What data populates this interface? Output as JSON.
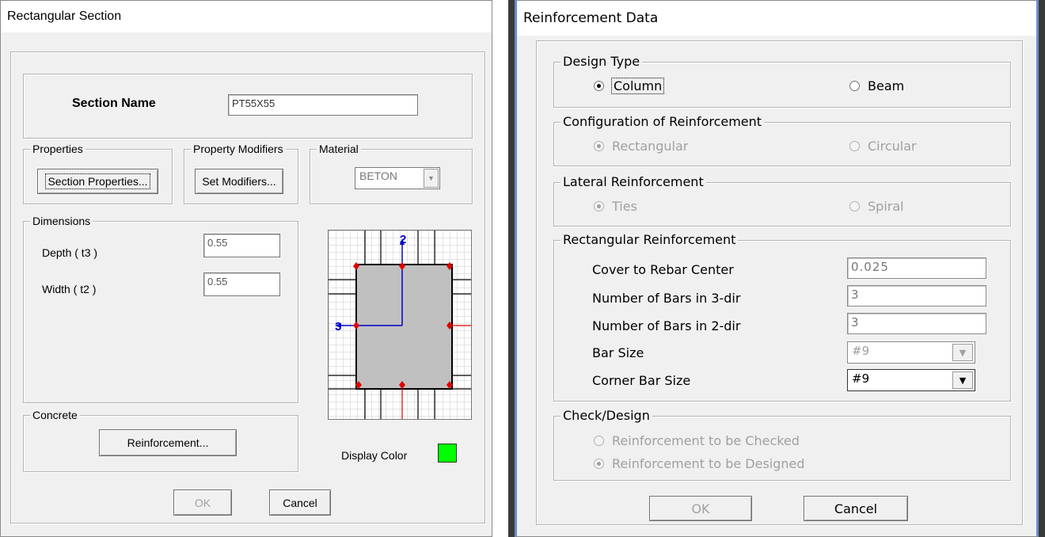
{
  "left_dialog": {
    "title": "Rectangular Section",
    "section_name_label": "Section Name",
    "section_name_value": "PT55X55",
    "properties_group": "Properties",
    "section_properties_button": "Section Properties...",
    "modifiers_group": "Property Modifiers",
    "set_modifiers_button": "Set Modifiers...",
    "material_group": "Material",
    "material_value": "BETON",
    "dimensions_group": "Dimensions",
    "depth_label": "Depth ( t3 )",
    "depth_value": "0.55",
    "width_label": "Width ( t2 )",
    "width_value": "0.55",
    "axis_2": "2",
    "axis_3": "3",
    "concrete_group": "Concrete",
    "reinforcement_button": "Reinforcement...",
    "display_color_label": "Display Color",
    "display_color": "#00ff00",
    "ok_button": "OK",
    "cancel_button": "Cancel"
  },
  "right_dialog": {
    "title": "Reinforcement Data",
    "design_type_group": "Design Type",
    "column_option": "Column",
    "beam_option": "Beam",
    "configuration_group": "Configuration of Reinforcement",
    "rectangular_option": "Rectangular",
    "circular_option": "Circular",
    "lateral_group": "Lateral Reinforcement",
    "ties_option": "Ties",
    "spiral_option": "Spiral",
    "rect_reinf_group": "Rectangular Reinforcement",
    "cover_label": "Cover to Rebar Center",
    "cover_value": "0.025",
    "bars3_label": "Number of Bars in 3-dir",
    "bars3_value": "3",
    "bars2_label": "Number of Bars in 2-dir",
    "bars2_value": "3",
    "bar_size_label": "Bar Size",
    "bar_size_value": "#9",
    "corner_bar_label": "Corner Bar Size",
    "corner_bar_value": "#9",
    "check_design_group": "Check/Design",
    "checked_option": "Reinforcement to be Checked",
    "designed_option": "Reinforcement to be Designed",
    "ok_button": "OK",
    "cancel_button": "Cancel"
  },
  "colors": {
    "rebar": "#e00000",
    "axis": "#0000cc",
    "section_fill": "#c0c0c0"
  }
}
